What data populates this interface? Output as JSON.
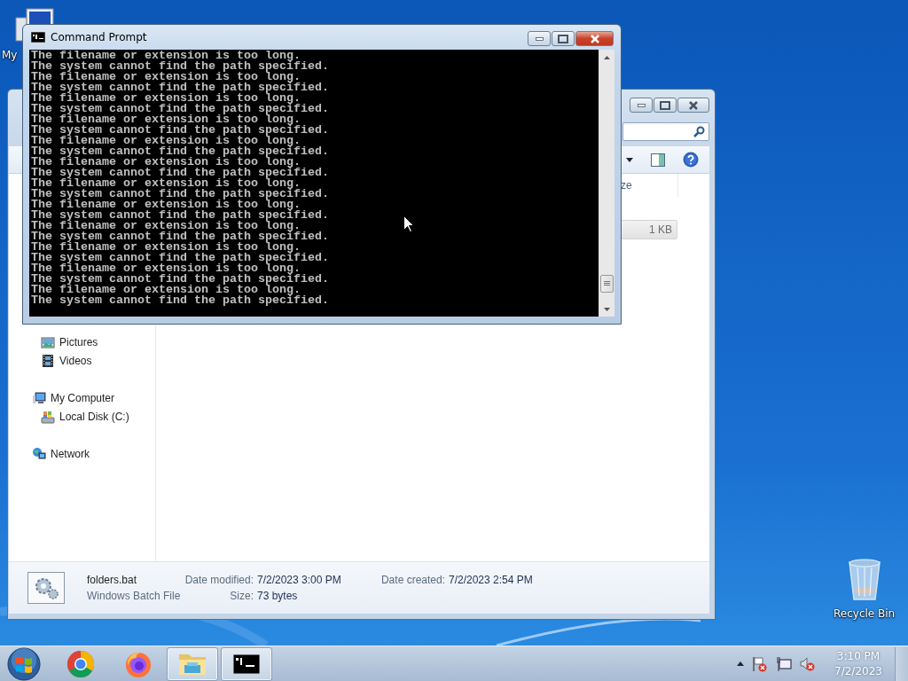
{
  "desktop_icons": [
    {
      "kind": "computer",
      "label": "My"
    },
    {
      "kind": "recycle-bin",
      "label": "Recycle Bin"
    }
  ],
  "explorer_window": {
    "column_header": "ze",
    "files": [
      {
        "size": "1 KB",
        "selected": true
      }
    ],
    "nav_tree": [
      {
        "children": [
          {
            "kind": "pictures",
            "label": "Pictures"
          },
          {
            "kind": "videos",
            "label": "Videos"
          }
        ]
      },
      {
        "kind": "computer",
        "label": "My Computer",
        "children": [
          {
            "kind": "disk",
            "label": "Local Disk (C:)"
          }
        ]
      },
      {
        "kind": "network",
        "label": "Network"
      }
    ],
    "details": {
      "name": "folders.bat",
      "type": "Windows Batch File",
      "modified_label": "Date modified:",
      "modified": "7/2/2023 3:00 PM",
      "size_label": "Size:",
      "size": "73 bytes",
      "created_label": "Date created:",
      "created": "7/2/2023 2:54 PM"
    }
  },
  "command_prompt": {
    "title": "Command Prompt",
    "lines": [
      "The filename or extension is too long.",
      "The system cannot find the path specified.",
      "The filename or extension is too long.",
      "The system cannot find the path specified.",
      "The filename or extension is too long.",
      "The system cannot find the path specified.",
      "The filename or extension is too long.",
      "The system cannot find the path specified.",
      "The filename or extension is too long.",
      "The system cannot find the path specified.",
      "The filename or extension is too long.",
      "The system cannot find the path specified.",
      "The filename or extension is too long.",
      "The system cannot find the path specified.",
      "The filename or extension is too long.",
      "The system cannot find the path specified.",
      "The filename or extension is too long.",
      "The system cannot find the path specified.",
      "The filename or extension is too long.",
      "The system cannot find the path specified.",
      "The filename or extension is too long.",
      "The system cannot find the path specified.",
      "The filename or extension is too long.",
      "The system cannot find the path specified."
    ]
  },
  "taskbar": {
    "apps": [
      {
        "kind": "chrome",
        "running": false
      },
      {
        "kind": "firefox",
        "running": false
      },
      {
        "kind": "explorer",
        "running": true
      },
      {
        "kind": "console",
        "running": true
      }
    ],
    "clock": {
      "time": "3:10 PM",
      "date": "7/2/2023"
    }
  }
}
